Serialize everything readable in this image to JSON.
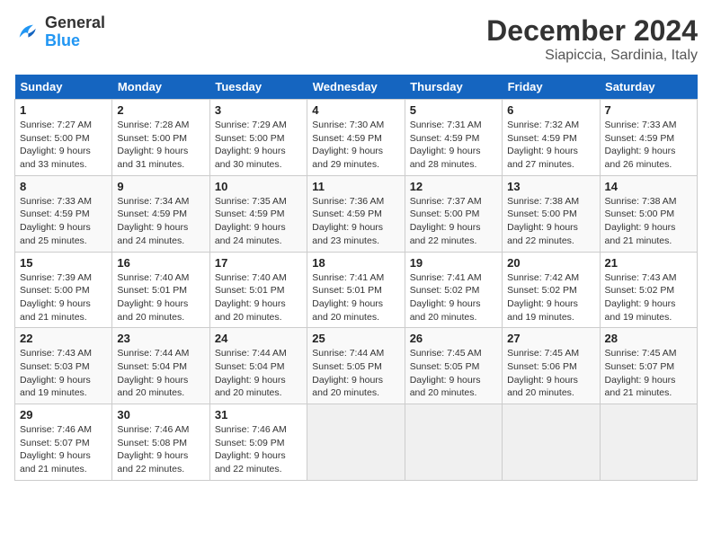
{
  "header": {
    "logo_general": "General",
    "logo_blue": "Blue",
    "month": "December 2024",
    "location": "Siapiccia, Sardinia, Italy"
  },
  "weekdays": [
    "Sunday",
    "Monday",
    "Tuesday",
    "Wednesday",
    "Thursday",
    "Friday",
    "Saturday"
  ],
  "weeks": [
    [
      {
        "day": "1",
        "info": "Sunrise: 7:27 AM\nSunset: 5:00 PM\nDaylight: 9 hours\nand 33 minutes."
      },
      {
        "day": "2",
        "info": "Sunrise: 7:28 AM\nSunset: 5:00 PM\nDaylight: 9 hours\nand 31 minutes."
      },
      {
        "day": "3",
        "info": "Sunrise: 7:29 AM\nSunset: 5:00 PM\nDaylight: 9 hours\nand 30 minutes."
      },
      {
        "day": "4",
        "info": "Sunrise: 7:30 AM\nSunset: 4:59 PM\nDaylight: 9 hours\nand 29 minutes."
      },
      {
        "day": "5",
        "info": "Sunrise: 7:31 AM\nSunset: 4:59 PM\nDaylight: 9 hours\nand 28 minutes."
      },
      {
        "day": "6",
        "info": "Sunrise: 7:32 AM\nSunset: 4:59 PM\nDaylight: 9 hours\nand 27 minutes."
      },
      {
        "day": "7",
        "info": "Sunrise: 7:33 AM\nSunset: 4:59 PM\nDaylight: 9 hours\nand 26 minutes."
      }
    ],
    [
      {
        "day": "8",
        "info": "Sunrise: 7:33 AM\nSunset: 4:59 PM\nDaylight: 9 hours\nand 25 minutes."
      },
      {
        "day": "9",
        "info": "Sunrise: 7:34 AM\nSunset: 4:59 PM\nDaylight: 9 hours\nand 24 minutes."
      },
      {
        "day": "10",
        "info": "Sunrise: 7:35 AM\nSunset: 4:59 PM\nDaylight: 9 hours\nand 24 minutes."
      },
      {
        "day": "11",
        "info": "Sunrise: 7:36 AM\nSunset: 4:59 PM\nDaylight: 9 hours\nand 23 minutes."
      },
      {
        "day": "12",
        "info": "Sunrise: 7:37 AM\nSunset: 5:00 PM\nDaylight: 9 hours\nand 22 minutes."
      },
      {
        "day": "13",
        "info": "Sunrise: 7:38 AM\nSunset: 5:00 PM\nDaylight: 9 hours\nand 22 minutes."
      },
      {
        "day": "14",
        "info": "Sunrise: 7:38 AM\nSunset: 5:00 PM\nDaylight: 9 hours\nand 21 minutes."
      }
    ],
    [
      {
        "day": "15",
        "info": "Sunrise: 7:39 AM\nSunset: 5:00 PM\nDaylight: 9 hours\nand 21 minutes."
      },
      {
        "day": "16",
        "info": "Sunrise: 7:40 AM\nSunset: 5:01 PM\nDaylight: 9 hours\nand 20 minutes."
      },
      {
        "day": "17",
        "info": "Sunrise: 7:40 AM\nSunset: 5:01 PM\nDaylight: 9 hours\nand 20 minutes."
      },
      {
        "day": "18",
        "info": "Sunrise: 7:41 AM\nSunset: 5:01 PM\nDaylight: 9 hours\nand 20 minutes."
      },
      {
        "day": "19",
        "info": "Sunrise: 7:41 AM\nSunset: 5:02 PM\nDaylight: 9 hours\nand 20 minutes."
      },
      {
        "day": "20",
        "info": "Sunrise: 7:42 AM\nSunset: 5:02 PM\nDaylight: 9 hours\nand 19 minutes."
      },
      {
        "day": "21",
        "info": "Sunrise: 7:43 AM\nSunset: 5:02 PM\nDaylight: 9 hours\nand 19 minutes."
      }
    ],
    [
      {
        "day": "22",
        "info": "Sunrise: 7:43 AM\nSunset: 5:03 PM\nDaylight: 9 hours\nand 19 minutes."
      },
      {
        "day": "23",
        "info": "Sunrise: 7:44 AM\nSunset: 5:04 PM\nDaylight: 9 hours\nand 20 minutes."
      },
      {
        "day": "24",
        "info": "Sunrise: 7:44 AM\nSunset: 5:04 PM\nDaylight: 9 hours\nand 20 minutes."
      },
      {
        "day": "25",
        "info": "Sunrise: 7:44 AM\nSunset: 5:05 PM\nDaylight: 9 hours\nand 20 minutes."
      },
      {
        "day": "26",
        "info": "Sunrise: 7:45 AM\nSunset: 5:05 PM\nDaylight: 9 hours\nand 20 minutes."
      },
      {
        "day": "27",
        "info": "Sunrise: 7:45 AM\nSunset: 5:06 PM\nDaylight: 9 hours\nand 20 minutes."
      },
      {
        "day": "28",
        "info": "Sunrise: 7:45 AM\nSunset: 5:07 PM\nDaylight: 9 hours\nand 21 minutes."
      }
    ],
    [
      {
        "day": "29",
        "info": "Sunrise: 7:46 AM\nSunset: 5:07 PM\nDaylight: 9 hours\nand 21 minutes."
      },
      {
        "day": "30",
        "info": "Sunrise: 7:46 AM\nSunset: 5:08 PM\nDaylight: 9 hours\nand 22 minutes."
      },
      {
        "day": "31",
        "info": "Sunrise: 7:46 AM\nSunset: 5:09 PM\nDaylight: 9 hours\nand 22 minutes."
      },
      {
        "day": "",
        "info": ""
      },
      {
        "day": "",
        "info": ""
      },
      {
        "day": "",
        "info": ""
      },
      {
        "day": "",
        "info": ""
      }
    ]
  ]
}
